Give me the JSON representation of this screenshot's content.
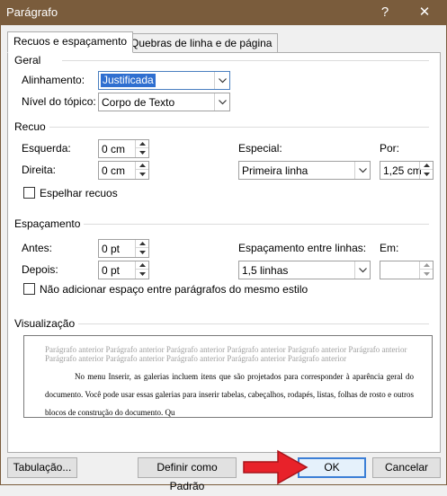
{
  "window": {
    "title": "Parágrafo",
    "help_label": "?",
    "close_label": "✕"
  },
  "tabs": [
    {
      "label": "Recuos e espaçamento",
      "active": true
    },
    {
      "label": "Quebras de linha e de página",
      "active": false
    }
  ],
  "geral": {
    "section": "Geral",
    "alinhamento_label": "Alinhamento:",
    "alinhamento_value": "Justificada",
    "nivel_label": "Nível do tópico:",
    "nivel_value": "Corpo de Texto"
  },
  "recuo": {
    "section": "Recuo",
    "esquerda_label": "Esquerda:",
    "esquerda_value": "0 cm",
    "direita_label": "Direita:",
    "direita_value": "0 cm",
    "especial_label": "Especial:",
    "especial_value": "Primeira linha",
    "por_label": "Por:",
    "por_value": "1,25 cm",
    "espelhar_label": "Espelhar recuos"
  },
  "espacamento": {
    "section": "Espaçamento",
    "antes_label": "Antes:",
    "antes_value": "0 pt",
    "depois_label": "Depois:",
    "depois_value": "0 pt",
    "entre_linhas_label": "Espaçamento entre linhas:",
    "entre_linhas_value": "1,5 linhas",
    "em_label": "Em:",
    "em_value": "",
    "nao_adicionar_label": "Não adicionar espaço entre parágrafos do mesmo estilo"
  },
  "visualizacao": {
    "section": "Visualização",
    "prior_line_1": "Parágrafo anterior Parágrafo anterior Parágrafo anterior Parágrafo anterior Parágrafo anterior Parágrafo anterior",
    "prior_line_2": "Parágrafo anterior Parágrafo anterior Parágrafo anterior Parágrafo anterior Parágrafo anterior",
    "sample_text": "No menu Inserir, as galerias incluem itens que são projetados para corresponder à aparência geral do documento. Você pode usar essas galerias para inserir tabelas, cabeçalhos, rodapés, listas, folhas de rosto e outros blocos de construção do documento. Qu"
  },
  "buttons": {
    "tabulacao": "Tabulação...",
    "definir_padrao": "Definir como Padrão",
    "ok": "OK",
    "cancelar": "Cancelar"
  },
  "annotation": {
    "arrow_color": "#e8222a"
  },
  "colors": {
    "titlebar": "#7a5c3c",
    "selection": "#2f6fd0",
    "default_button_border": "#3c7fd6"
  }
}
